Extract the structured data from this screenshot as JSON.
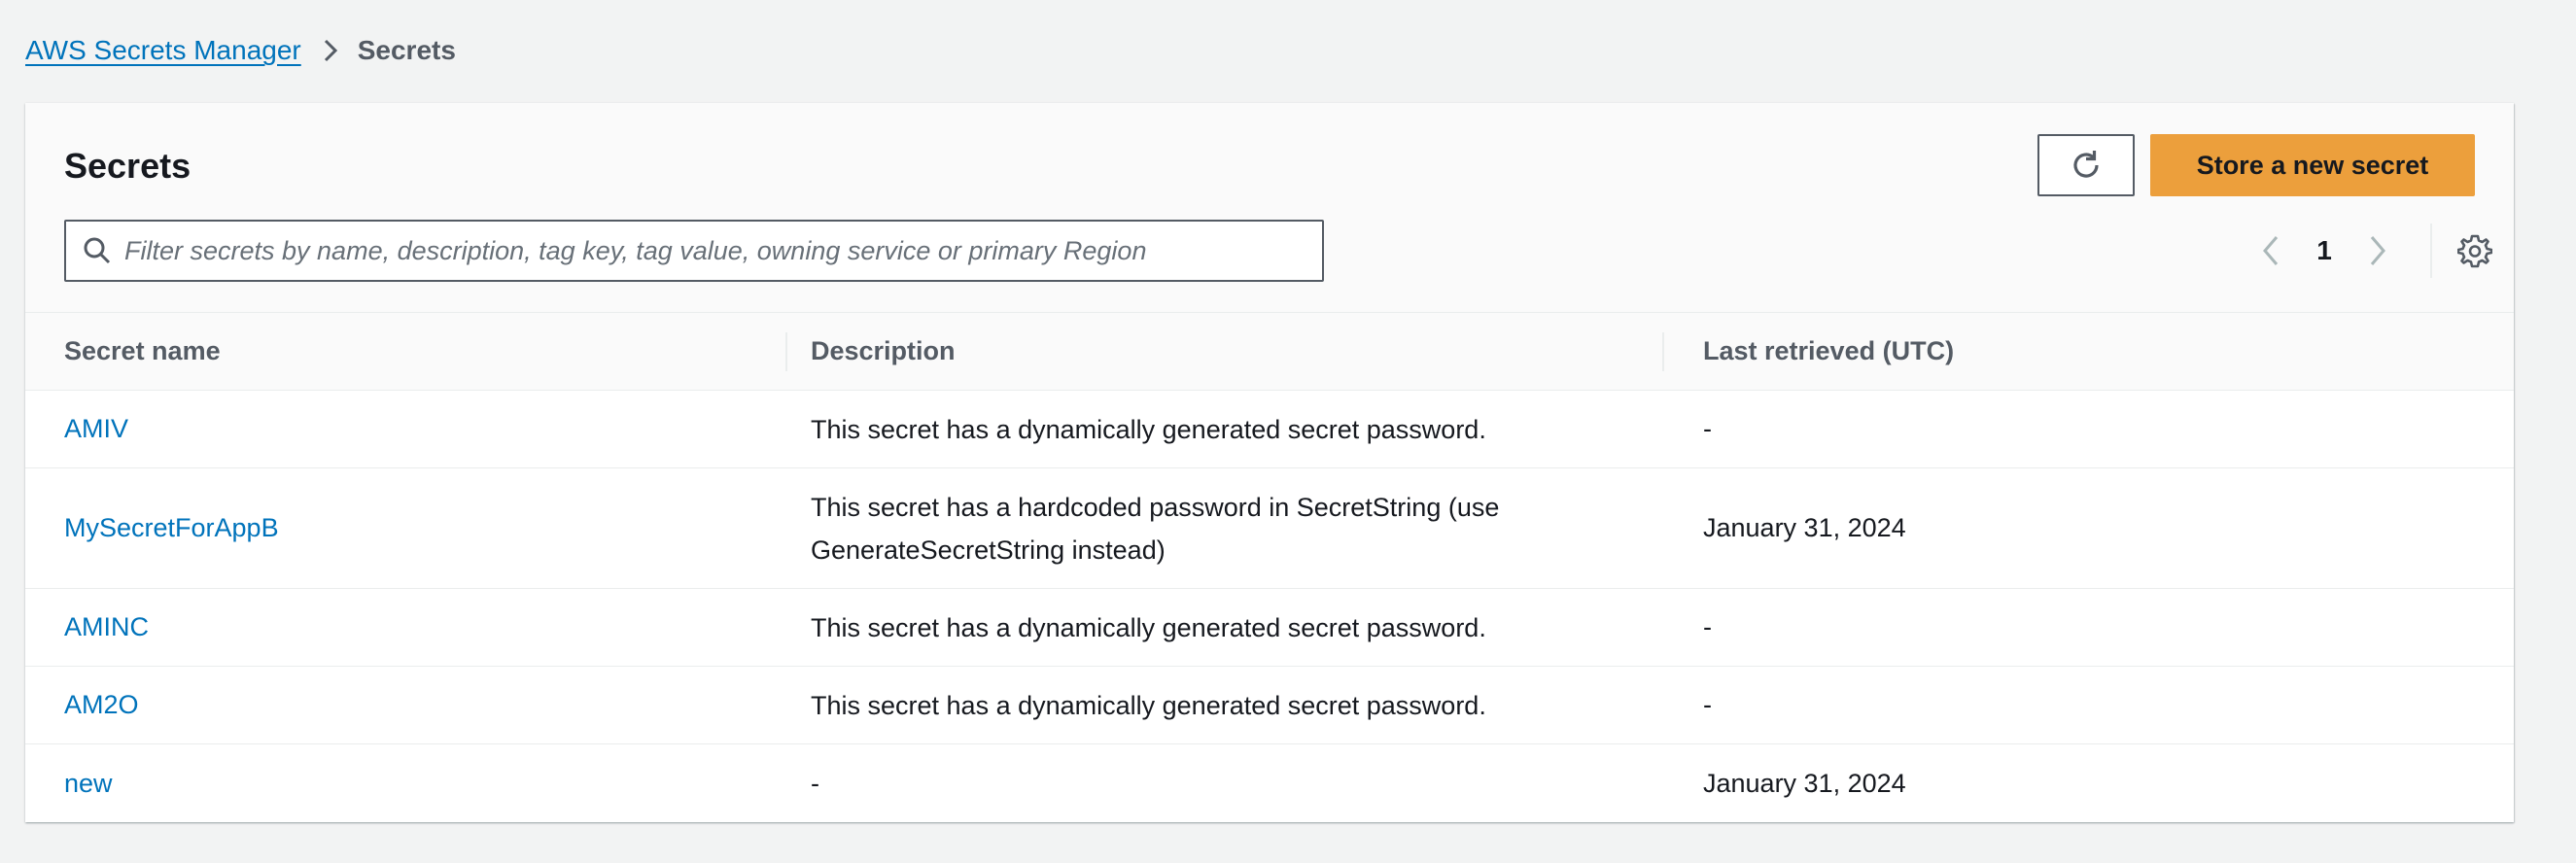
{
  "breadcrumb": {
    "root": "AWS Secrets Manager",
    "current": "Secrets"
  },
  "panel": {
    "title": "Secrets",
    "store_button": "Store a new secret",
    "refresh_icon": "refresh-icon",
    "search_placeholder": "Filter secrets by name, description, tag key, tag value, owning service or primary Region",
    "search_value": ""
  },
  "pagination": {
    "current_page": "1"
  },
  "table": {
    "columns": [
      "Secret name",
      "Description",
      "Last retrieved (UTC)"
    ],
    "rows": [
      {
        "name": "AMIV",
        "description": "This secret has a dynamically generated secret password.",
        "last_retrieved": "-"
      },
      {
        "name": "MySecretForAppB",
        "description": "This secret has a hardcoded password in SecretString (use GenerateSecretString instead)",
        "last_retrieved": "January 31, 2024"
      },
      {
        "name": "AMINC",
        "description": "This secret has a dynamically generated secret password.",
        "last_retrieved": "-"
      },
      {
        "name": "AM2O",
        "description": "This secret has a dynamically generated secret password.",
        "last_retrieved": "-"
      },
      {
        "name": "new",
        "description": "-",
        "last_retrieved": "January 31, 2024"
      }
    ]
  },
  "colors": {
    "link": "#0073bb",
    "primary_button": "#ec9f3c",
    "background": "#f2f3f3",
    "header_text": "#545b64"
  }
}
